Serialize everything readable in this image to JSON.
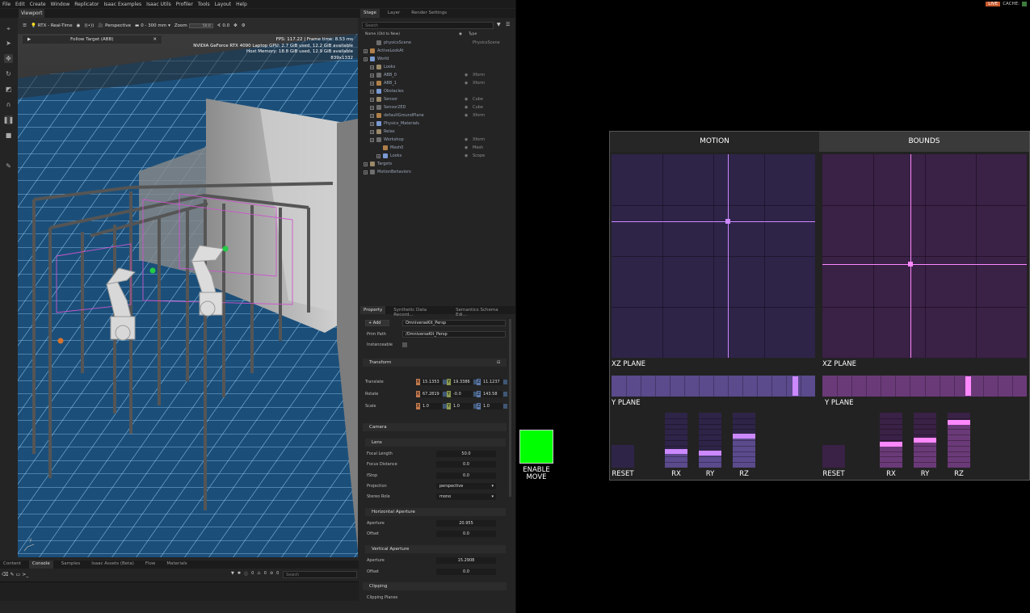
{
  "menubar": {
    "items": [
      "File",
      "Edit",
      "Create",
      "Window",
      "Replicator",
      "Isaac Examples",
      "Isaac Utils",
      "Profiler",
      "Tools",
      "Layout",
      "Help"
    ],
    "live_label": "LIVE",
    "cache_label": "CACHE:",
    "cache_color": "#3c7a3c"
  },
  "viewport": {
    "tab_label": "Viewport",
    "toolbar": {
      "render_mode": "RTX - Real-Time",
      "camera": "Perspective",
      "lens_range": "0 - 300 mm",
      "zoom_label": "Zoom",
      "zoom_value": "50.0",
      "angle_value": "0.0"
    },
    "follow_target": "Follow Target (ABB)",
    "stats": {
      "fps": "FPS: 117.22 | Frame time: 8.53 ms",
      "gpu": "NVIDIA GeForce RTX 4090 Laptop GPU: 2.7 GiB used, 12.2 GiB available",
      "host": "Host Memory: 18.8 GiB used, 12.9 GiB available",
      "resolution": "839x1332"
    },
    "floor_color": "#1b4f7a",
    "selection_color": "#cc55cc"
  },
  "bottom": {
    "tabs": [
      "Content",
      "Console",
      "Samples",
      "Isaac Assets (Beta)",
      "Flow",
      "Materials"
    ],
    "active_tab": "Console",
    "counts": [
      "0",
      "0",
      "0"
    ],
    "search_placeholder": "Search"
  },
  "stage": {
    "tabs": [
      "Stage",
      "Layer",
      "Render Settings"
    ],
    "active_tab": "Stage",
    "search_placeholder": "Search",
    "col_name": "Name (Old to New)",
    "col_type": "Type",
    "rows": [
      {
        "name": "physicsScene",
        "type": "PhysicsScene",
        "depth": 1,
        "eye": false,
        "exp": false
      },
      {
        "name": "ActiveLookAt",
        "type": "",
        "depth": 0,
        "eye": false,
        "exp": true
      },
      {
        "name": "World",
        "type": "",
        "depth": 0,
        "eye": false,
        "exp": true
      },
      {
        "name": "Looks",
        "type": "",
        "depth": 1,
        "eye": false,
        "exp": true
      },
      {
        "name": "ABB_0",
        "type": "Xform",
        "depth": 1,
        "eye": true,
        "exp": true
      },
      {
        "name": "ABB_1",
        "type": "Xform",
        "depth": 1,
        "eye": true,
        "exp": true
      },
      {
        "name": "Obstacles",
        "type": "",
        "depth": 1,
        "eye": false,
        "exp": true
      },
      {
        "name": "Sensor",
        "type": "Cube",
        "depth": 1,
        "eye": true,
        "exp": true
      },
      {
        "name": "Sensor2ED",
        "type": "Cube",
        "depth": 1,
        "eye": true,
        "exp": true
      },
      {
        "name": "defaultGroundPlane",
        "type": "Xform",
        "depth": 1,
        "eye": true,
        "exp": true
      },
      {
        "name": "Physics_Materials",
        "type": "",
        "depth": 1,
        "eye": false,
        "exp": true
      },
      {
        "name": "Relax",
        "type": "",
        "depth": 1,
        "eye": false,
        "exp": true
      },
      {
        "name": "Workshop",
        "type": "Xform",
        "depth": 1,
        "eye": true,
        "exp": true
      },
      {
        "name": "Mesh0",
        "type": "Mesh",
        "depth": 2,
        "eye": true,
        "exp": false
      },
      {
        "name": "Looks",
        "type": "Scope",
        "depth": 2,
        "eye": true,
        "exp": true
      },
      {
        "name": "Targets",
        "type": "",
        "depth": 0,
        "eye": false,
        "exp": true
      },
      {
        "name": "MotionBehaviors",
        "type": "",
        "depth": 0,
        "eye": false,
        "exp": true
      }
    ]
  },
  "property": {
    "tabs": [
      "Property",
      "Synthetic Data Record...",
      "Semantics Schema Edi..."
    ],
    "active_tab": "Property",
    "add_label": "Add",
    "prim_name": "OmniverseKit_Persp",
    "prim_path_label": "Prim Path",
    "prim_path": "/OmniverseKit_Persp",
    "instanceable_label": "Instanceable",
    "transform_label": "Transform",
    "translate_label": "Translate",
    "translate": [
      "15.1353",
      "19.3386",
      "11.1237"
    ],
    "rotate_label": "Rotate",
    "rotate": [
      "67.2819",
      "-0.0",
      "143.58"
    ],
    "scale_label": "Scale",
    "scale": [
      "1.0",
      "1.0",
      "1.0"
    ],
    "camera_label": "Camera",
    "lens_label": "Lens",
    "focal_length_label": "Focal Length",
    "focal_length": "50.0",
    "focus_distance_label": "Focus Distance",
    "focus_distance": "0.0",
    "fstop_label": "fStop",
    "fstop": "0.0",
    "projection_label": "Projection",
    "projection": "perspective",
    "stereo_label": "Stereo Role",
    "stereo": "mono",
    "h_aperture_label": "Horizontal Aperture",
    "aperture_label": "Aperture",
    "h_aperture": "20.955",
    "offset_label": "Offset",
    "h_offset": "0.0",
    "v_aperture_label": "Vertical Aperture",
    "v_aperture": "15.2908",
    "v_offset": "0.0",
    "clipping_label": "Clipping",
    "clipping_planes_label": "Clipping Planes"
  },
  "enable_move": {
    "label_line1": "ENABLE",
    "label_line2": "MOVE",
    "color": "#00ff00"
  },
  "control_panel": {
    "tabs": [
      "MOTION",
      "BOUNDS"
    ],
    "active_tab": "MOTION",
    "motion": {
      "xz_label": "XZ PLANE",
      "y_label": "Y PLANE",
      "xz_point": {
        "x": 0.57,
        "z": 0.33
      },
      "y_value": 0.9,
      "plane_color": "#2e2448",
      "slider_color": "#5b4a8c",
      "accent_color": "#cc88ff",
      "reset_label": "RESET",
      "bars": [
        {
          "label": "RX",
          "value": 0.3
        },
        {
          "label": "RY",
          "value": 0.27
        },
        {
          "label": "RZ",
          "value": 0.57
        }
      ]
    },
    "bounds": {
      "xz_label": "XZ PLANE",
      "y_label": "Y PLANE",
      "xz_point": {
        "x": 0.43,
        "z": 0.54
      },
      "y_value": 0.71,
      "plane_color": "#3a2146",
      "slider_color": "#6a3a78",
      "accent_color": "#ff88ff",
      "reset_label": "RESET",
      "bars": [
        {
          "label": "RX",
          "value": 0.42
        },
        {
          "label": "RY",
          "value": 0.5
        },
        {
          "label": "RZ",
          "value": 0.83
        }
      ]
    }
  }
}
